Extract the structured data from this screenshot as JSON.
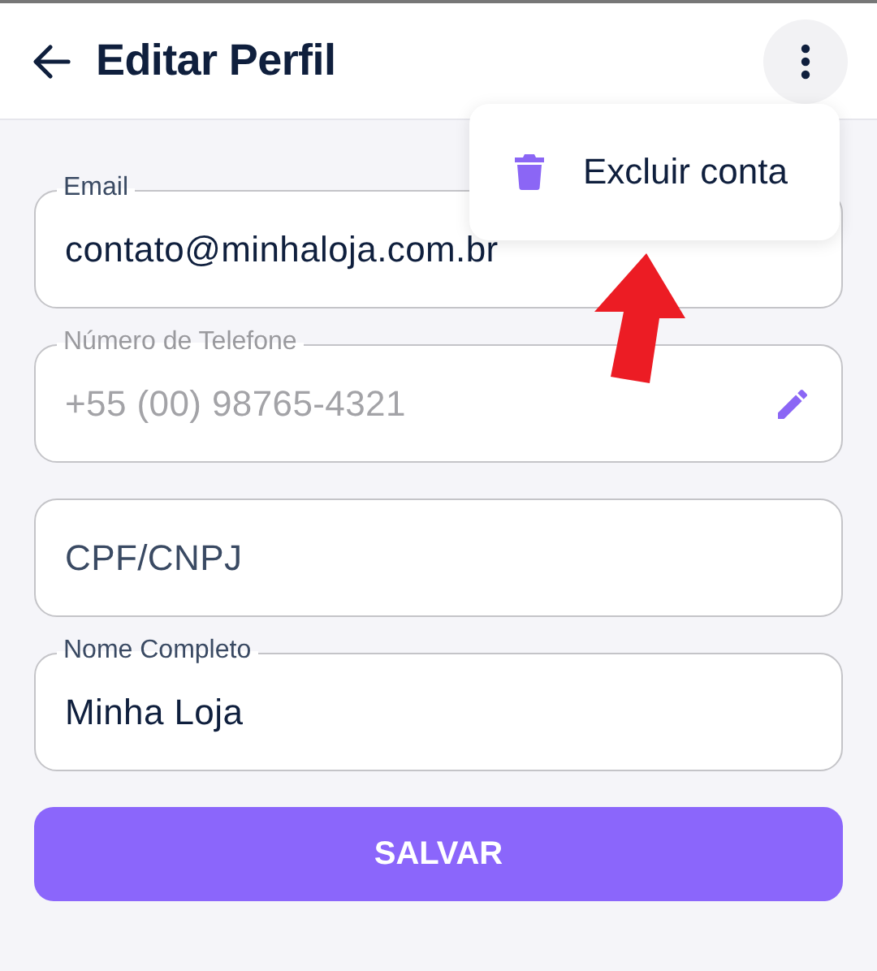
{
  "header": {
    "title": "Editar Perfil"
  },
  "menu": {
    "open": true,
    "items": [
      {
        "label": "Excluir conta"
      }
    ]
  },
  "fields": [
    {
      "label": "Email",
      "value": "contato@minhaloja.com.br",
      "disabled": false,
      "editable": false
    },
    {
      "label": "Número de Telefone",
      "value": "+55 (00) 98765-4321",
      "disabled": true,
      "editable": true
    },
    {
      "placeholder": "CPF/CNPJ",
      "disabled": false,
      "editable": false
    },
    {
      "label": "Nome Completo",
      "value": "Minha Loja",
      "disabled": false,
      "editable": false
    }
  ],
  "save_button": "SALVAR",
  "annotation": {
    "kind": "arrow"
  }
}
